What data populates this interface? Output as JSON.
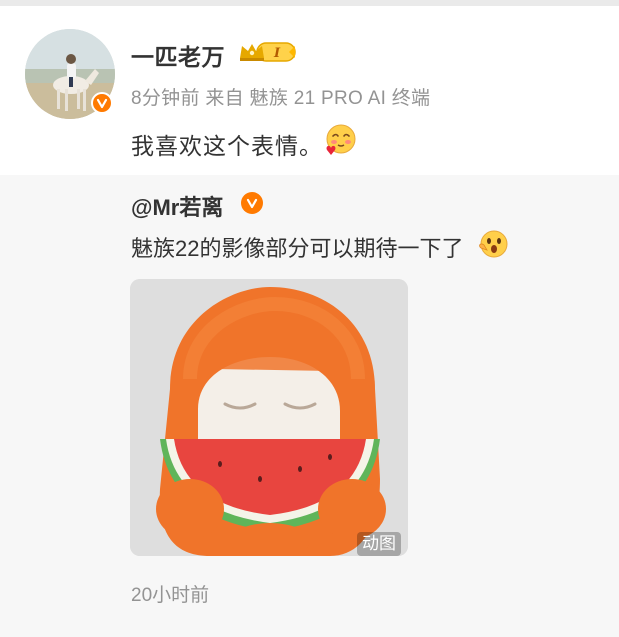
{
  "post": {
    "username": "一匹老万",
    "vip_level": "I",
    "meta": "8分钟前 来自 魅族 21 PRO AI 终端",
    "text": "我喜欢这个表情。",
    "text_emoji": "shy-blush-emoji"
  },
  "repost": {
    "username": "@Mr若离",
    "text": "魅族22的影像部分可以期待一下了",
    "text_emoji": "surprised-emoji",
    "media_label": "动图",
    "time": "20小时前"
  },
  "colors": {
    "accent": "#ff7a00",
    "text": "#333333",
    "muted": "#939393",
    "repost_bg": "#f7f7f7"
  },
  "icons": [
    "avatar-image",
    "verified-icon",
    "vip-crown-icon",
    "shy-blush-emoji",
    "surprised-emoji",
    "watermelon-mascot-gif"
  ]
}
